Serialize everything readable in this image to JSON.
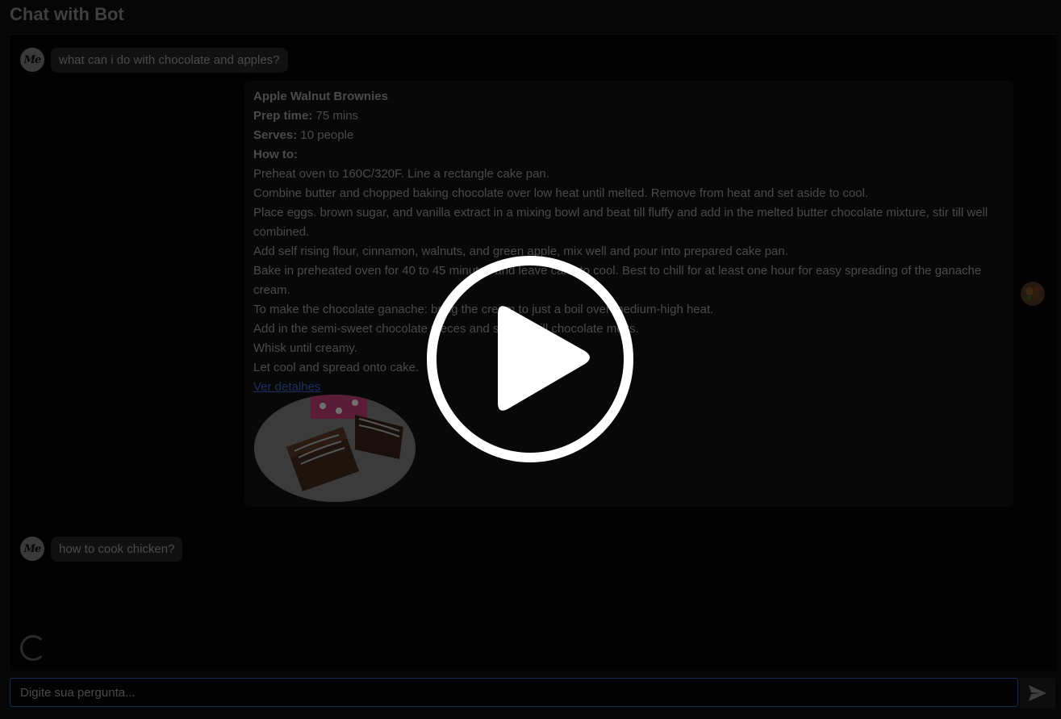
{
  "page": {
    "title": "Chat with Bot"
  },
  "messages": [
    {
      "role": "user",
      "text": "what can i do with chocolate and apples?"
    },
    {
      "role": "user",
      "text": "how to cook chicken?"
    }
  ],
  "recipe": {
    "name": "Apple Walnut Brownies",
    "prep_label": "Prep time:",
    "prep_value": "75 mins",
    "serves_label": "Serves:",
    "serves_value": "10 people",
    "howto_label": "How to:",
    "steps": [
      "Preheat oven to 160C/320F. Line a rectangle cake pan.",
      "Combine butter and chopped baking chocolate over low heat until melted. Remove from heat and set aside to cool.",
      "Place eggs. brown sugar, and vanilla extract in a mixing bowl and beat till fluffy and add in the melted butter chocolate mixture, stir till well combined.",
      "Add self rising flour, cinnamon, walnuts, and green apple, mix well and pour into prepared cake pan.",
      "Bake in preheated oven for 40 to 45 minutes and leave cake to cool. Best to chill for at least one hour for easy spreading of the ganache cream.",
      "To make the chocolate ganache: bring the cream to just a boil over medium-high heat.",
      "Add in the semi-sweet chocolate pieces and stir well till chocolate melts.",
      "Whisk until creamy.",
      "Let cool and spread onto cake."
    ],
    "details_link": "Ver detalhes"
  },
  "input": {
    "placeholder": "Digite sua pergunta..."
  },
  "icons": {
    "user_avatar": "me-logo-icon",
    "bot_avatar": "food-avatar-icon",
    "send": "paper-plane-icon",
    "play": "play-icon",
    "loading": "spinner-icon"
  },
  "colors": {
    "link": "#1d2e63",
    "input_border": "#1a2a55"
  }
}
